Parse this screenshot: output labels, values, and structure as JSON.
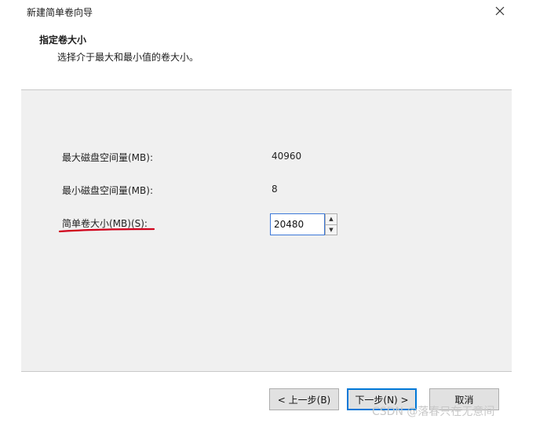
{
  "window": {
    "title": "新建简单卷向导"
  },
  "header": {
    "title": "指定卷大小",
    "subtitle": "选择介于最大和最小值的卷大小。"
  },
  "fields": {
    "max_label": "最大磁盘空间量(MB):",
    "max_value": "40960",
    "min_label": "最小磁盘空间量(MB):",
    "min_value": "8",
    "size_label": "简单卷大小(MB)(S):",
    "size_value": "20480"
  },
  "buttons": {
    "back": "< 上一步(B)",
    "next": "下一步(N) >",
    "cancel": "取消"
  },
  "watermark": "CSDN @落春只在无意间",
  "colors": {
    "underline": "#d0021b",
    "focus": "#0078d7"
  },
  "icons": {
    "close": "close-icon",
    "spin_up": "spin-up-icon",
    "spin_down": "spin-down-icon"
  }
}
